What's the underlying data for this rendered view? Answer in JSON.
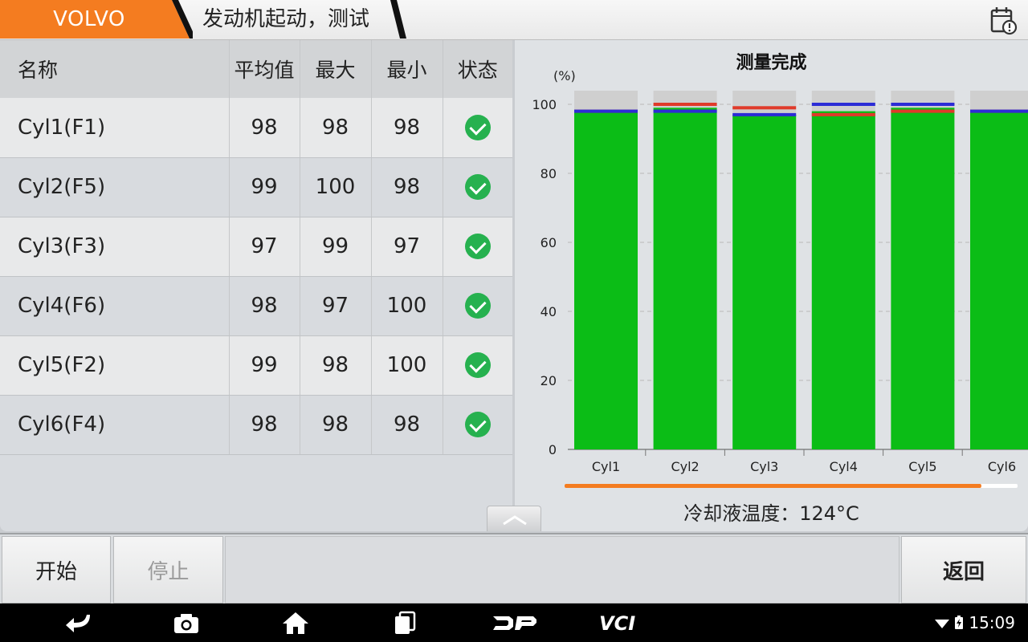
{
  "header": {
    "brand": "VOLVO",
    "title": "发动机起动，测试",
    "brand_color": "#f47c20"
  },
  "table": {
    "headers": [
      "名称",
      "平均值",
      "最大",
      "最小",
      "状态"
    ],
    "rows": [
      {
        "name": "Cyl1(F1)",
        "avg": "98",
        "max": "98",
        "min": "98",
        "status": "ok"
      },
      {
        "name": "Cyl2(F5)",
        "avg": "99",
        "max": "100",
        "min": "98",
        "status": "ok"
      },
      {
        "name": "Cyl3(F3)",
        "avg": "97",
        "max": "99",
        "min": "97",
        "status": "ok"
      },
      {
        "name": "Cyl4(F6)",
        "avg": "98",
        "max": "97",
        "min": "100",
        "status": "ok"
      },
      {
        "name": "Cyl5(F2)",
        "avg": "99",
        "max": "98",
        "min": "100",
        "status": "ok"
      },
      {
        "name": "Cyl6(F4)",
        "avg": "98",
        "max": "98",
        "min": "98",
        "status": "ok"
      }
    ]
  },
  "chart": {
    "title": "测量完成",
    "unit": "(%)",
    "coolant_label": "冷却液温度：",
    "coolant_value": "124°C"
  },
  "chart_data": {
    "type": "bar",
    "categories": [
      "Cyl1",
      "Cyl2",
      "Cyl3",
      "Cyl4",
      "Cyl5",
      "Cyl6"
    ],
    "values": [
      98,
      99,
      97,
      98,
      99,
      98
    ],
    "max_markers": [
      98,
      100,
      99,
      97,
      98,
      98
    ],
    "min_markers": [
      98,
      98,
      97,
      100,
      100,
      98
    ],
    "ylim": [
      0,
      100
    ],
    "yticks": [
      0,
      20,
      40,
      60,
      80,
      100
    ],
    "grid": true,
    "colors": {
      "bar": "#0bbd16",
      "max": "#e03a2a",
      "min": "#2c2cd6",
      "background_bar": "#cfcfcf"
    }
  },
  "scroll_progress": 0.92,
  "actions": {
    "start": "开始",
    "stop": "停止",
    "back": "返回"
  },
  "status_bar": {
    "time": "15:09",
    "icons": [
      "back-arrow-icon",
      "camera-icon",
      "home-icon",
      "recent-apps-icon",
      "dp-logo-icon",
      "vci-icon",
      "wifi-icon",
      "battery-icon"
    ]
  }
}
